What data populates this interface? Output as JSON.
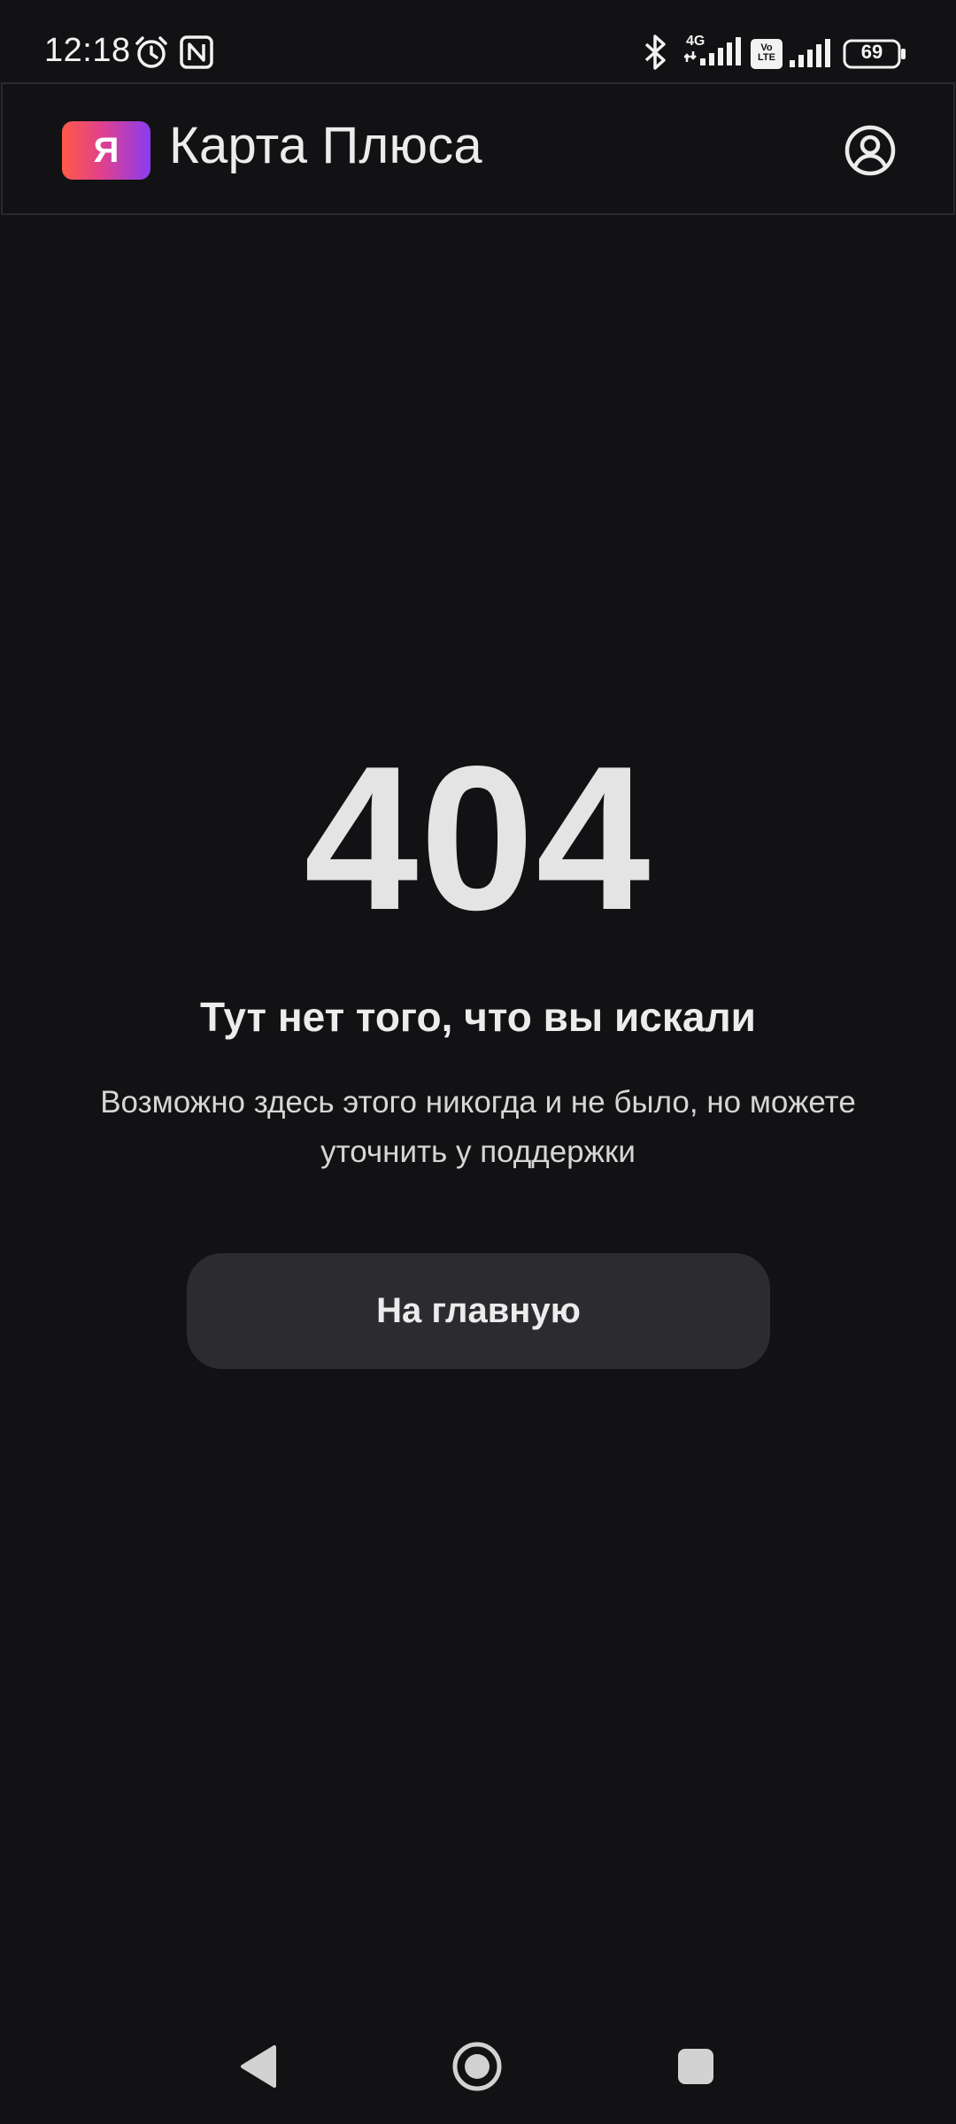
{
  "status_bar": {
    "time": "12:18",
    "network_label": "4G",
    "volte_label": "Vo\nLTE",
    "battery_level": "69",
    "icons": [
      "alarm-icon",
      "nfc-icon",
      "bluetooth-icon",
      "signal-icon",
      "volte-icon",
      "signal-icon",
      "battery-icon"
    ]
  },
  "header": {
    "logo_letter": "Я",
    "title": "Карта Плюса",
    "profile_icon": "user-circle-icon"
  },
  "error": {
    "code": "404",
    "title": "Тут нет того, что вы искали",
    "description": "Возможно здесь этого никогда и не было, но можете уточнить у поддержки",
    "home_button_label": "На главную"
  },
  "nav_bar": {
    "icons": [
      "back-icon",
      "home-icon",
      "recents-icon"
    ]
  },
  "colors": {
    "background": "#121214",
    "button": "#2c2c30",
    "text": "#e6e6e6",
    "logo_gradient_start": "#ff5a48",
    "logo_gradient_end": "#8a3cf0"
  }
}
